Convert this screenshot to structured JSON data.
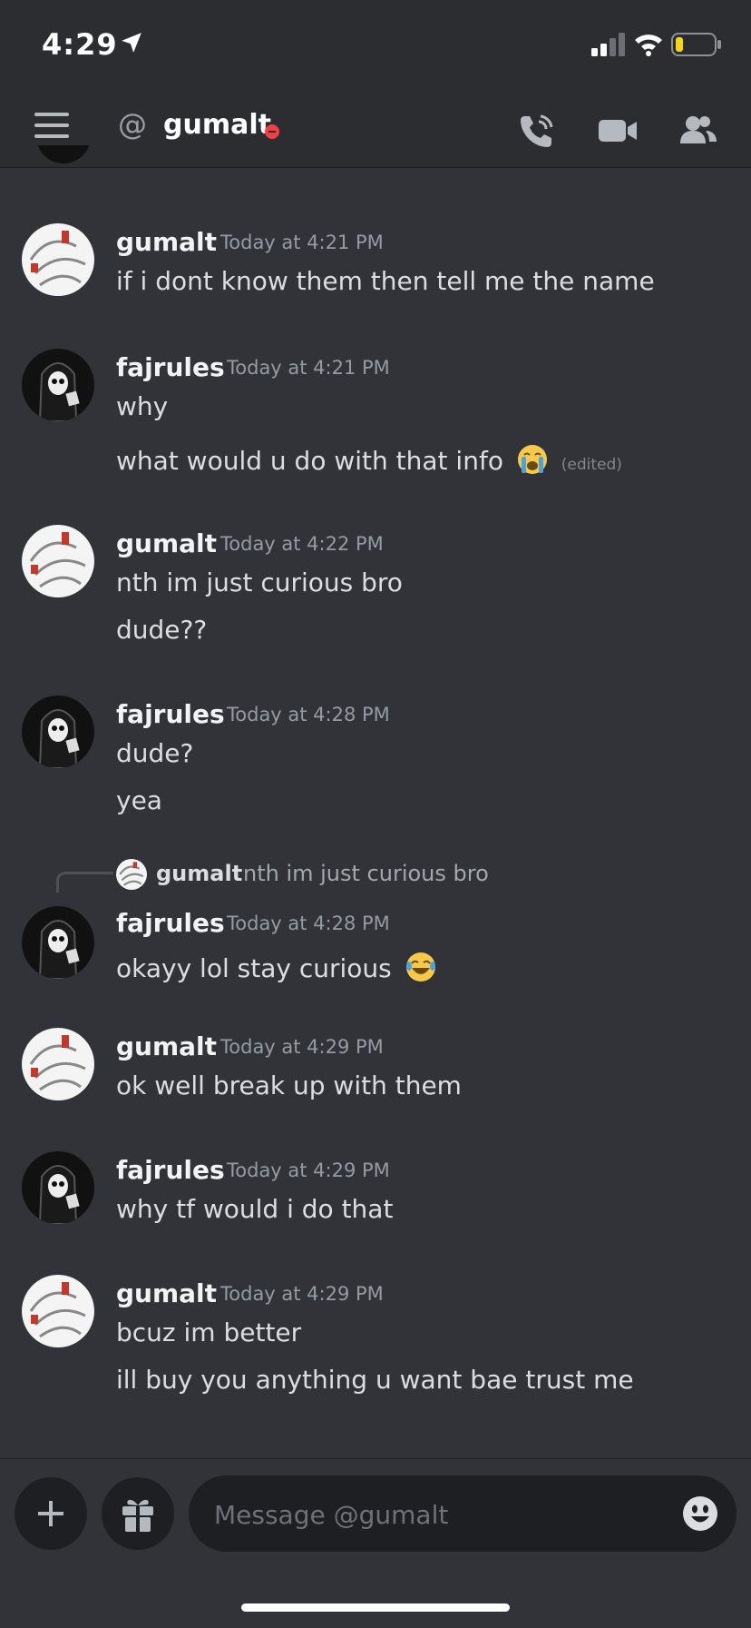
{
  "status_bar": {
    "time": "4:29"
  },
  "header": {
    "channel_name": "gumalt",
    "at_symbol": "@"
  },
  "messages": [
    {
      "author": "gumalt",
      "timestamp": "Today at 4:21 PM",
      "lines": [
        "if i dont know them then tell me the name"
      ]
    },
    {
      "author": "fajrules",
      "timestamp": "Today at 4:21 PM",
      "lines": [
        "why",
        "what would u do with that info"
      ],
      "edited_label": "(edited)"
    },
    {
      "author": "gumalt",
      "timestamp": "Today at 4:22 PM",
      "lines": [
        "nth im just curious bro",
        "dude??"
      ]
    },
    {
      "author": "fajrules",
      "timestamp": "Today at 4:28 PM",
      "lines": [
        "dude?",
        "yea"
      ]
    },
    {
      "author": "fajrules",
      "timestamp": "Today at 4:28 PM",
      "lines": [
        "okayy lol stay curious"
      ],
      "reply": {
        "author": "gumalt",
        "text": "nth im just curious bro"
      }
    },
    {
      "author": "gumalt",
      "timestamp": "Today at 4:29 PM",
      "lines": [
        "ok well break up with them"
      ]
    },
    {
      "author": "fajrules",
      "timestamp": "Today at 4:29 PM",
      "lines": [
        "why tf would i do that"
      ]
    },
    {
      "author": "gumalt",
      "timestamp": "Today at 4:29 PM",
      "lines": [
        "bcuz im better",
        "ill buy you anything u want bae trust me"
      ]
    }
  ],
  "composer": {
    "placeholder": "Message @gumalt"
  },
  "icons": {
    "menu": "hamburger-icon",
    "call": "phone-call-icon",
    "video": "video-camera-icon",
    "members": "members-icon",
    "add": "plus-icon",
    "gift": "gift-icon",
    "emoji": "smiley-icon"
  },
  "colors": {
    "background": "#313338",
    "header": "#2b2d31",
    "dnd": "#f23f43",
    "text": "#dbdee1",
    "muted": "#949ba4"
  }
}
